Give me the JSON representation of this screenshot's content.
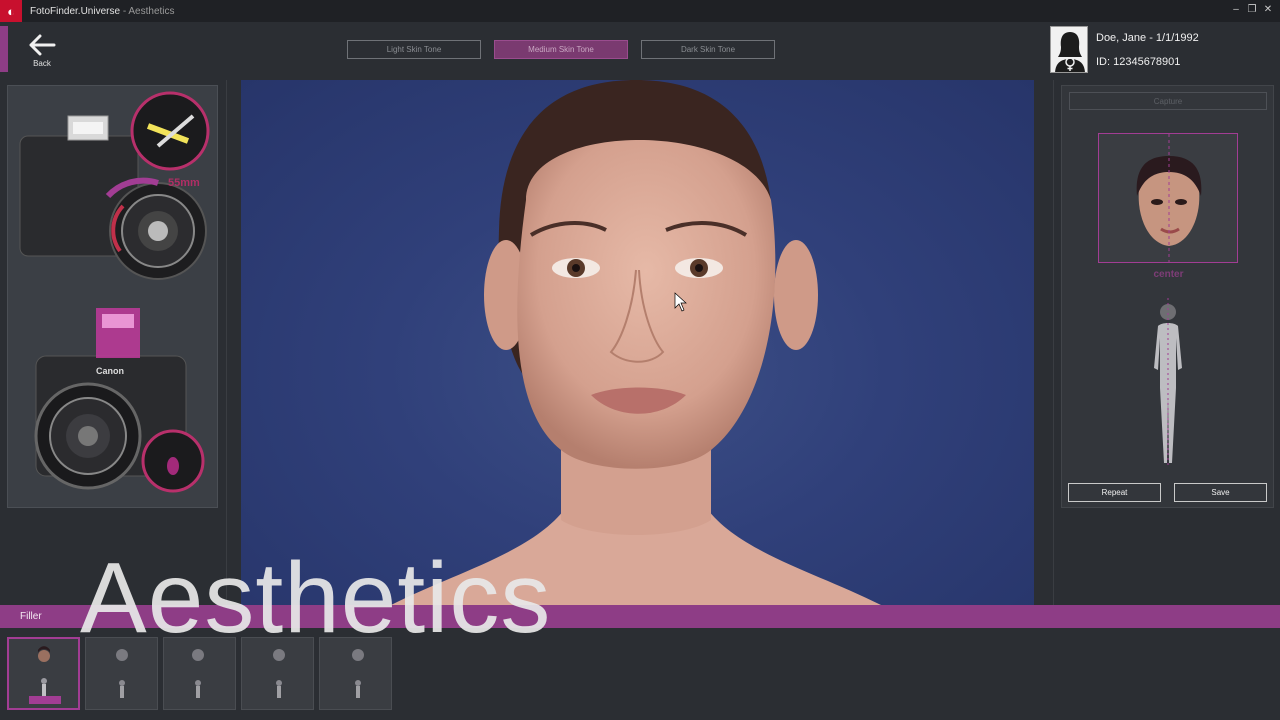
{
  "window": {
    "app_name": "FotoFinder.Universe",
    "separator": " - ",
    "module": "Aesthetics",
    "controls": [
      "–",
      "❐",
      "✕"
    ]
  },
  "header": {
    "back_label": "Back",
    "tones": [
      {
        "label": "Light Skin Tone",
        "active": false
      },
      {
        "label": "Medium Skin Tone",
        "active": true
      },
      {
        "label": "Dark Skin Tone",
        "active": false
      }
    ]
  },
  "patient": {
    "name": "Doe, Jane - 1/1/1992",
    "id": "ID: 12345678901"
  },
  "left_panel": {
    "lens_label": "55mm",
    "camera_brand": "Canon"
  },
  "right_panel": {
    "capture_label": "Capture",
    "position_label": "center",
    "repeat_label": "Repeat",
    "save_label": "Save"
  },
  "bottom": {
    "section_label": "Filler",
    "overlay_title": "Aesthetics",
    "thumbnail_count": 5
  },
  "colors": {
    "accent": "#8e3d86",
    "background": "#2b2e33",
    "photo_bg": "#30407a",
    "logo_red": "#c8102e"
  }
}
